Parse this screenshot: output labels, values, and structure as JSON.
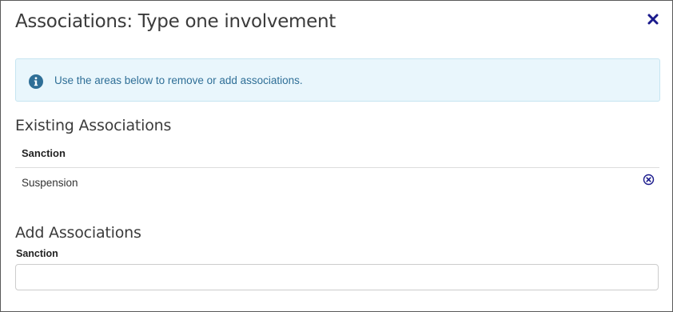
{
  "dialog": {
    "title": "Associations: Type one involvement",
    "close_icon": "close-icon",
    "close_color": "#1a1a8c"
  },
  "info": {
    "icon": "info-circle-icon",
    "message": "Use the areas below to remove or add associations."
  },
  "existing": {
    "title": "Existing Associations",
    "column_header": "Sanction",
    "rows": [
      {
        "value": "Suspension",
        "action_icon": "remove-circle-icon"
      }
    ]
  },
  "add": {
    "title": "Add Associations",
    "field_label": "Sanction",
    "field_value": ""
  },
  "colors": {
    "info_background": "#e9f6fc",
    "info_text": "#2f6f97",
    "accent": "#1a1a8c"
  }
}
